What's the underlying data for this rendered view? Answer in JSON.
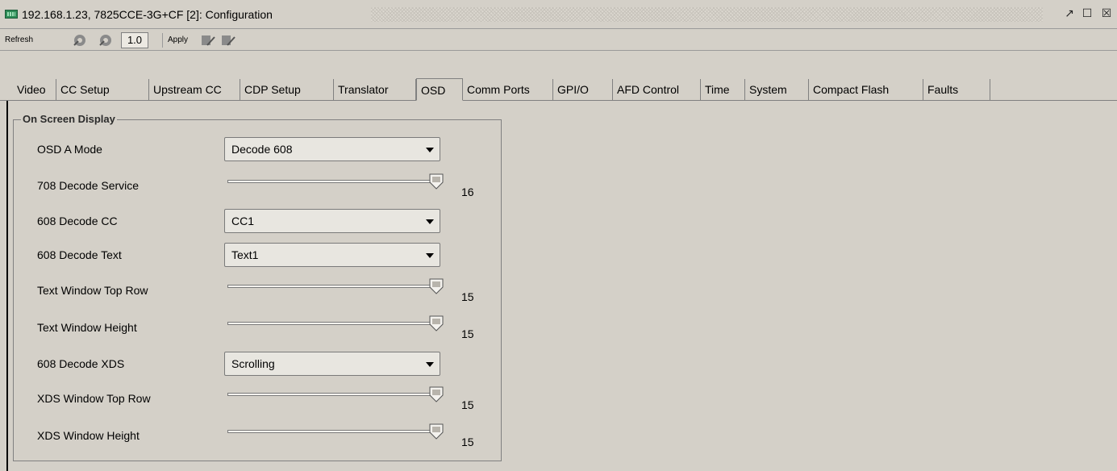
{
  "window": {
    "title": "192.168.1.23, 7825CCE-3G+CF  [2]: Configuration",
    "icon": "device-icon",
    "controls": [
      "restore-icon",
      "maximize-icon",
      "close-icon"
    ]
  },
  "toolbar": {
    "refresh_label": "Refresh",
    "version": "1.0",
    "apply_label": "Apply"
  },
  "tabs": [
    {
      "label": "Video"
    },
    {
      "label": "CC Setup"
    },
    {
      "label": "Upstream CC"
    },
    {
      "label": "CDP Setup"
    },
    {
      "label": "Translator"
    },
    {
      "label": "OSD",
      "active": true
    },
    {
      "label": "Comm Ports"
    },
    {
      "label": "GPI/O"
    },
    {
      "label": "AFD Control"
    },
    {
      "label": "Time"
    },
    {
      "label": "System"
    },
    {
      "label": "Compact Flash"
    },
    {
      "label": "Faults"
    }
  ],
  "group": {
    "title": "On Screen Display",
    "rows": [
      {
        "label": "OSD A Mode",
        "type": "combo",
        "value": "Decode 608"
      },
      {
        "label": "708 Decode Service",
        "type": "slider",
        "value": "16",
        "fill": 1.0
      },
      {
        "label": "608 Decode CC",
        "type": "combo",
        "value": "CC1"
      },
      {
        "label": "608 Decode Text",
        "type": "combo",
        "value": "Text1"
      },
      {
        "label": "Text Window Top Row",
        "type": "slider",
        "value": "15",
        "fill": 1.0
      },
      {
        "label": "Text Window Height",
        "type": "slider",
        "value": "15",
        "fill": 1.0
      },
      {
        "label": "608 Decode XDS",
        "type": "combo",
        "value": "Scrolling"
      },
      {
        "label": "XDS Window Top Row",
        "type": "slider",
        "value": "15",
        "fill": 1.0
      },
      {
        "label": "XDS Window Height",
        "type": "slider",
        "value": "15",
        "fill": 1.0
      }
    ]
  },
  "colors": {
    "background": "#d4d0c8",
    "icon_green": "#2e8b57"
  }
}
